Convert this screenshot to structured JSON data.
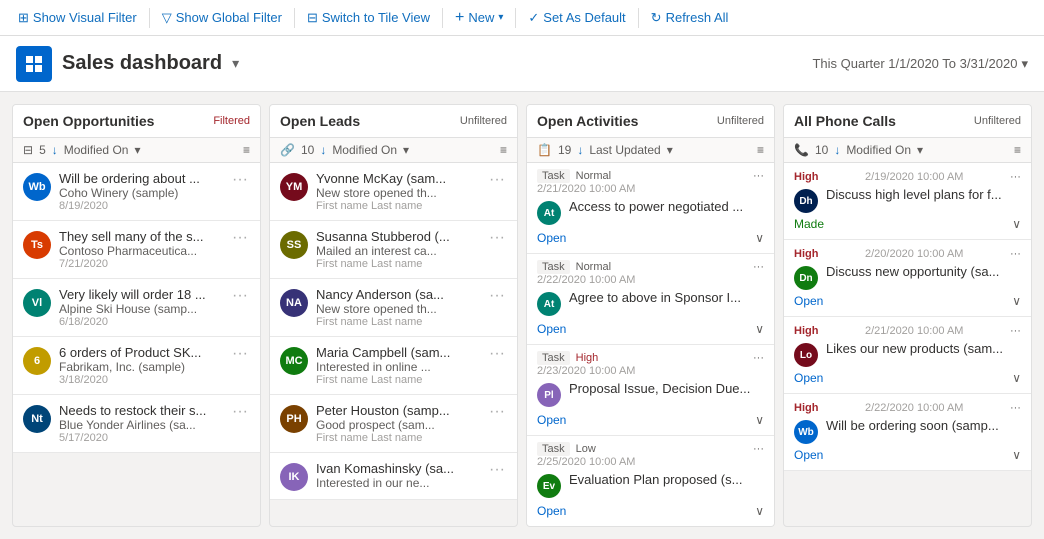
{
  "toolbar": {
    "show_visual_filter": "Show Visual Filter",
    "show_global_filter": "Show Global Filter",
    "switch_to_tile": "Switch to Tile View",
    "new": "New",
    "set_as_default": "Set As Default",
    "refresh_all": "Refresh All"
  },
  "header": {
    "title": "Sales dashboard",
    "date_range": "This Quarter 1/1/2020 To 3/31/2020"
  },
  "panels": {
    "open_opportunities": {
      "title": "Open Opportunities",
      "badge": "Filtered",
      "count": "5",
      "sort_by": "Modified On",
      "cards": [
        {
          "initials": "Wb",
          "color": "bg-blue",
          "title": "Will be ordering about ...",
          "company": "Coho Winery (sample)",
          "date": "8/19/2020"
        },
        {
          "initials": "Ts",
          "color": "bg-red",
          "title": "They sell many of the s...",
          "company": "Contoso Pharmaceutica...",
          "date": "7/21/2020"
        },
        {
          "initials": "Vl",
          "color": "bg-teal",
          "title": "Very likely will order 18 ...",
          "company": "Alpine Ski House (samp...",
          "date": "6/18/2020"
        },
        {
          "initials": "6",
          "color": "bg-number",
          "title": "6 orders of Product SK...",
          "company": "Fabrikam, Inc. (sample)",
          "date": "3/18/2020"
        },
        {
          "initials": "Nt",
          "color": "bg-navy",
          "title": "Needs to restock their s...",
          "company": "Blue Yonder Airlines (sa...",
          "date": "5/17/2020"
        }
      ]
    },
    "open_leads": {
      "title": "Open Leads",
      "badge": "Unfiltered",
      "count": "10",
      "sort_by": "Modified On",
      "cards": [
        {
          "initials": "YM",
          "color": "bg-maroon",
          "title": "Yvonne McKay (sam...",
          "desc": "New store opened th...",
          "meta": "First name Last name"
        },
        {
          "initials": "SS",
          "color": "bg-olive",
          "title": "Susanna Stubberod (...",
          "desc": "Mailed an interest ca...",
          "meta": "First name Last name"
        },
        {
          "initials": "NA",
          "color": "bg-indigo",
          "title": "Nancy Anderson (sa...",
          "desc": "New store opened th...",
          "meta": "First name Last name"
        },
        {
          "initials": "MC",
          "color": "bg-green",
          "title": "Maria Campbell (sam...",
          "desc": "Interested in online ...",
          "meta": "First name Last name"
        },
        {
          "initials": "PH",
          "color": "bg-brown",
          "title": "Peter Houston (samp...",
          "desc": "Good prospect (sam...",
          "meta": "First name Last name"
        },
        {
          "initials": "IK",
          "color": "bg-purple",
          "title": "Ivan Komashinsky (sa...",
          "desc": "Interested in our ne...",
          "meta": ""
        }
      ]
    },
    "open_activities": {
      "title": "Open Activities",
      "badge": "Unfiltered",
      "count": "19",
      "sort_by": "Last Updated",
      "items": [
        {
          "type": "Task",
          "priority": "Normal",
          "datetime": "2/21/2020 10:00 AM",
          "avatar": "At",
          "color": "bg-teal",
          "title": "Access to power negotiated ...",
          "status": "Open"
        },
        {
          "type": "Task",
          "priority": "Normal",
          "datetime": "2/22/2020 10:00 AM",
          "avatar": "At",
          "color": "bg-teal",
          "title": "Agree to above in Sponsor I...",
          "status": "Open"
        },
        {
          "type": "Task",
          "priority": "High",
          "datetime": "2/23/2020 10:00 AM",
          "avatar": "Pl",
          "color": "bg-purple",
          "title": "Proposal Issue, Decision Due...",
          "status": "Open"
        },
        {
          "type": "Task",
          "priority": "Low",
          "datetime": "2/25/2020 10:00 AM",
          "avatar": "Ev",
          "color": "bg-green",
          "title": "Evaluation Plan proposed (s...",
          "status": "Open"
        }
      ]
    },
    "phone_calls": {
      "title": "All Phone Calls",
      "badge": "Unfiltered",
      "count": "10",
      "sort_by": "Modified On",
      "items": [
        {
          "priority": "High",
          "datetime": "2/19/2020 10:00 AM",
          "avatar": "Dh",
          "color": "bg-darkblue",
          "title": "Discuss high level plans for f...",
          "status": "Made"
        },
        {
          "priority": "High",
          "datetime": "2/20/2020 10:00 AM",
          "avatar": "Dn",
          "color": "bg-green",
          "title": "Discuss new opportunity (sa...",
          "status": "Open"
        },
        {
          "priority": "High",
          "datetime": "2/21/2020 10:00 AM",
          "avatar": "Lo",
          "color": "bg-maroon",
          "title": "Likes our new products (sam...",
          "status": "Open"
        },
        {
          "priority": "High",
          "datetime": "2/22/2020 10:00 AM",
          "avatar": "Wb",
          "color": "bg-blue",
          "title": "Will be ordering soon (samp...",
          "status": "Open"
        }
      ]
    }
  }
}
